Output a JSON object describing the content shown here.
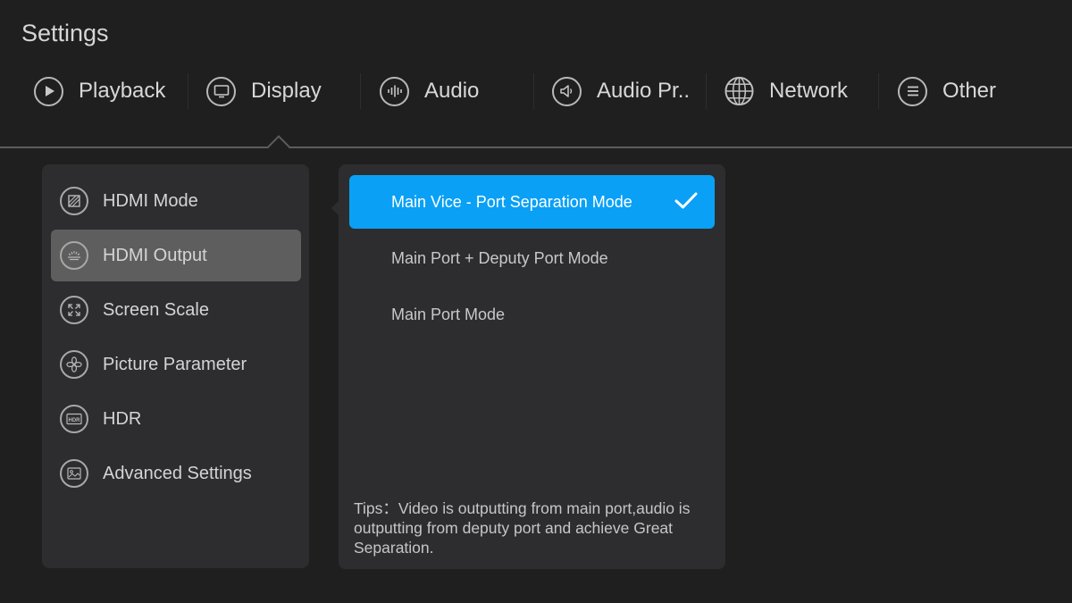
{
  "header": {
    "title": "Settings"
  },
  "tabs": [
    {
      "label": "Playback",
      "icon": "play-icon"
    },
    {
      "label": "Display",
      "icon": "monitor-icon"
    },
    {
      "label": "Audio",
      "icon": "audio-wave-icon"
    },
    {
      "label": "Audio Pr..",
      "icon": "speaker-icon"
    },
    {
      "label": "Network",
      "icon": "globe-icon"
    },
    {
      "label": "Other",
      "icon": "menu-icon"
    }
  ],
  "active_tab": "Display",
  "menu": {
    "items": [
      {
        "label": "HDMI Mode",
        "icon": "hdmi-mode-icon"
      },
      {
        "label": "HDMI Output",
        "icon": "hdmi-output-icon"
      },
      {
        "label": "Screen Scale",
        "icon": "expand-icon"
      },
      {
        "label": "Picture Parameter",
        "icon": "flower-icon"
      },
      {
        "label": "HDR",
        "icon": "hdr-icon"
      },
      {
        "label": "Advanced Settings",
        "icon": "image-icon"
      }
    ],
    "selected": "HDMI Output"
  },
  "options": {
    "items": [
      {
        "label": "Main Vice - Port Separation Mode"
      },
      {
        "label": "Main Port + Deputy Port Mode"
      },
      {
        "label": "Main Port Mode"
      }
    ],
    "selected": "Main Vice - Port Separation Mode",
    "tips": "Tips：Video is outputting from main port,audio is outputting from deputy port and achieve Great Separation."
  },
  "colors": {
    "background": "#1f1f1f",
    "panel": "#2d2d2f",
    "accent": "#0aa0f5",
    "selected_menu": "#5e5e5e"
  }
}
